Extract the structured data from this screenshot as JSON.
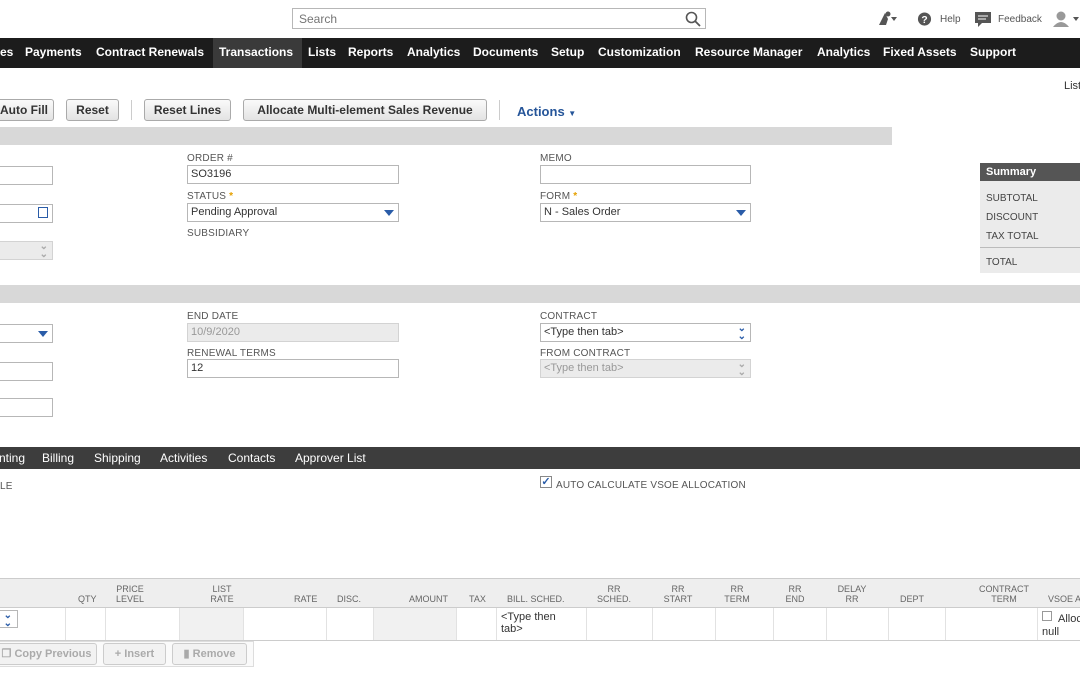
{
  "search": {
    "placeholder": "Search"
  },
  "header": {
    "help_label": "Help",
    "feedback_label": "Feedback"
  },
  "nav": {
    "items": [
      "es",
      "Payments",
      "Contract Renewals",
      "Transactions",
      "Lists",
      "Reports",
      "Analytics",
      "Documents",
      "Setup",
      "Customization",
      "Resource Manager",
      "Analytics",
      "Fixed Assets",
      "Support"
    ],
    "active_index": 3
  },
  "list_link": "List",
  "toolbar": {
    "auto_fill": "Auto Fill",
    "reset": "Reset",
    "reset_lines": "Reset Lines",
    "allocate": "Allocate Multi-element Sales Revenue",
    "actions": "Actions"
  },
  "primary": {
    "order_label": "ORDER #",
    "order_value": "SO3196",
    "status_label": "STATUS",
    "status_value": "Pending Approval",
    "subsidiary_label": "SUBSIDIARY",
    "memo_label": "MEMO",
    "memo_value": "",
    "form_label": "FORM",
    "form_value": "N - Sales Order"
  },
  "summary": {
    "title": "Summary",
    "subtotal": "SUBTOTAL",
    "discount": "DISCOUNT",
    "tax_total": "TAX TOTAL",
    "total": "TOTAL"
  },
  "contract": {
    "end_date_label": "END DATE",
    "end_date_value": "10/9/2020",
    "renewal_terms_label": "RENEWAL TERMS",
    "renewal_terms_value": "12",
    "contract_label": "CONTRACT",
    "contract_value": "<Type then tab>",
    "from_contract_label": "FROM CONTRACT",
    "from_contract_value": "<Type then tab>"
  },
  "subtabs": [
    "nting",
    "Billing",
    "Shipping",
    "Activities",
    "Contacts",
    "Approver List"
  ],
  "items_section": {
    "left_label": "LE",
    "auto_calc_label": "AUTO CALCULATE VSOE ALLOCATION",
    "auto_calc_checked": true
  },
  "grid": {
    "columns": [
      "QTY",
      "PRICE LEVEL",
      "LIST RATE",
      "RATE",
      "DISC.",
      "AMOUNT",
      "TAX",
      "BILL. SCHED.",
      "RR SCHED.",
      "RR START",
      "RR TERM",
      "RR END",
      "DELAY RR",
      "DEPT",
      "CONTRACT TERM",
      "VSOE A"
    ],
    "row": {
      "bill_sched": "<Type then tab>",
      "vsoe": "Alloc",
      "vsoe_null": "null"
    }
  },
  "grid_buttons": {
    "copy_previous": "Copy Previous",
    "insert": "Insert",
    "remove": "Remove"
  },
  "colors": {
    "nav_bg": "#1c1c1c",
    "accent": "#255599",
    "required": "#e5a000"
  }
}
